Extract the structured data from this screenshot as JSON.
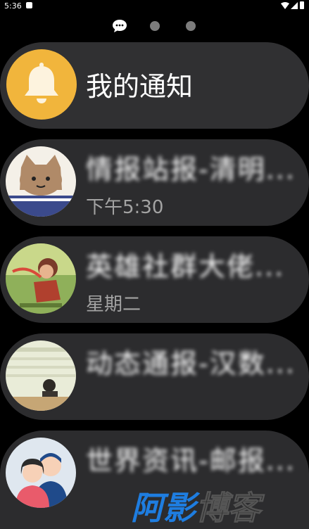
{
  "status_bar": {
    "time": "5:36",
    "icons": [
      "notification-icon",
      "wifi-icon",
      "signal-icon",
      "battery-icon"
    ]
  },
  "pager": {
    "icons": [
      "chat-bubble-icon",
      "page-dot",
      "page-dot"
    ]
  },
  "header": {
    "title": "我的通知",
    "icon": "bell-icon",
    "icon_color": "#f1b53c"
  },
  "notifications": [
    {
      "title": "情报站报-清明...",
      "time": "下午5:30",
      "avatar": "cartoon-cat-avatar"
    },
    {
      "title": "英雄社群大佬...",
      "time": "星期二",
      "avatar": "game-character-avatar"
    },
    {
      "title": "动态通报-汉数...",
      "time": "",
      "avatar": "classroom-photo-avatar"
    },
    {
      "title": "世界资讯-邮报...",
      "time": "",
      "avatar": "two-people-avatar"
    }
  ],
  "watermark": {
    "text_blue": "阿影",
    "text_dark": "博客"
  },
  "colors": {
    "background": "#000000",
    "card": "#2c2c2e",
    "secondary_text": "#a3a3a3"
  }
}
